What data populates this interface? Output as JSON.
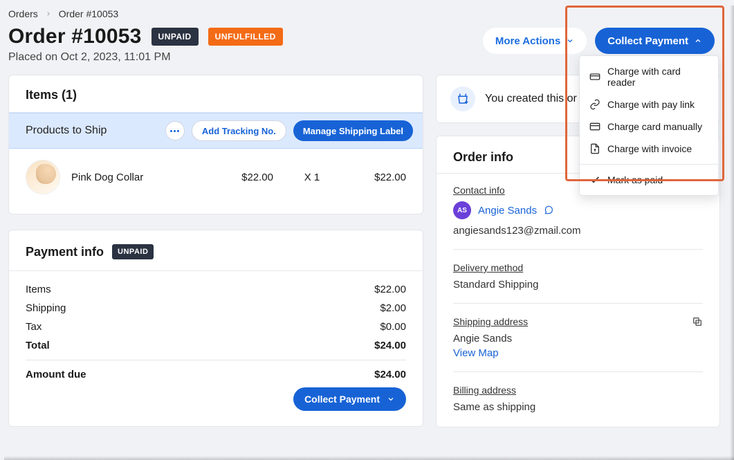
{
  "breadcrumb": {
    "root": "Orders",
    "current": "Order #10053"
  },
  "header": {
    "title": "Order #10053",
    "paid_badge": "UNPAID",
    "fulfill_badge": "UNFULFILLED",
    "placed": "Placed on Oct 2, 2023, 11:01 PM"
  },
  "top_actions": {
    "more": "More Actions",
    "collect": "Collect Payment"
  },
  "dropdown": {
    "items": [
      {
        "icon": "card-reader",
        "label": "Charge with card reader"
      },
      {
        "icon": "pay-link",
        "label": "Charge with pay link"
      },
      {
        "icon": "card-manual",
        "label": "Charge card manually"
      },
      {
        "icon": "invoice",
        "label": "Charge with invoice"
      }
    ],
    "separator_item": {
      "icon": "check",
      "label": "Mark as paid"
    }
  },
  "items_card": {
    "title": "Items (1)",
    "ship_label": "Products to Ship",
    "add_tracking": "Add Tracking No.",
    "manage_label": "Manage Shipping Label",
    "product": {
      "name": "Pink Dog Collar",
      "price": "$22.00",
      "qty": "X 1",
      "total": "$22.00"
    }
  },
  "payment_card": {
    "title": "Payment info",
    "badge": "UNPAID",
    "lines": {
      "items_label": "Items",
      "items_val": "$22.00",
      "ship_label": "Shipping",
      "ship_val": "$2.00",
      "tax_label": "Tax",
      "tax_val": "$0.00",
      "total_label": "Total",
      "total_val": "$24.00",
      "due_label": "Amount due",
      "due_val": "$24.00"
    },
    "collect": "Collect Payment"
  },
  "notif": {
    "text": "You created this or"
  },
  "order_info": {
    "title": "Order info",
    "contact_label": "Contact info",
    "avatar_initials": "AS",
    "name": "Angie Sands",
    "email": "angiesands123@zmail.com",
    "delivery_label": "Delivery method",
    "delivery_value": "Standard Shipping",
    "ship_addr_label": "Shipping address",
    "ship_name": "Angie Sands",
    "view_map": "View Map",
    "bill_addr_label": "Billing address",
    "bill_value": "Same as shipping"
  }
}
